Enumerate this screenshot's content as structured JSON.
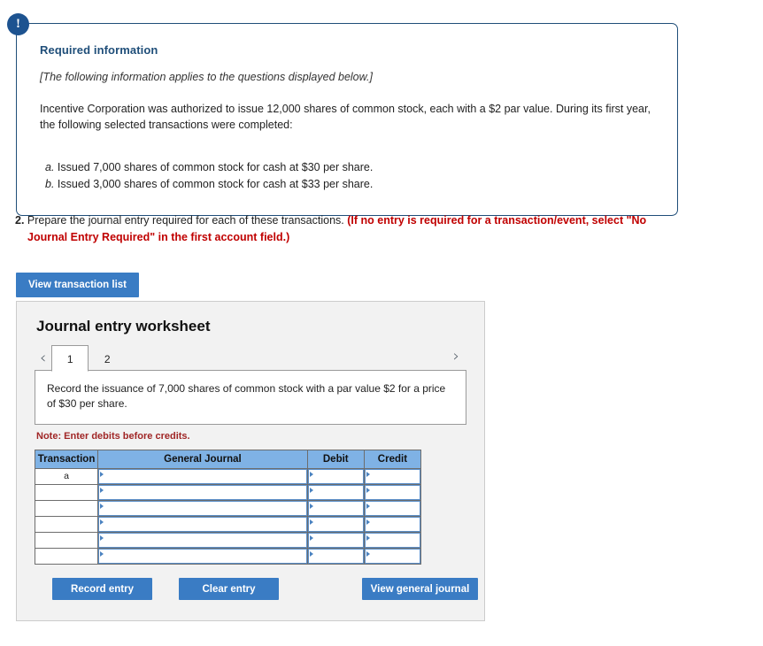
{
  "info_box": {
    "badge_icon": "exclamation-icon",
    "badge_glyph": "!",
    "title": "Required information",
    "italic_note": "[The following information applies to the questions displayed below.]",
    "paragraph": "Incentive Corporation was authorized to issue 12,000 shares of common stock, each with a $2 par value. During its first year, the following selected transactions were completed:",
    "items": [
      {
        "marker": "a.",
        "text": " Issued 7,000 shares of common stock for cash at $30 per share."
      },
      {
        "marker": "b.",
        "text": " Issued 3,000 shares of common stock for cash at $33 per share."
      }
    ],
    "border_color": "#1f4e79",
    "badge_color": "#1d5390"
  },
  "question": {
    "number": "2.",
    "text": " Prepare the journal entry required for each of these transactions. ",
    "red_line1": "(If no entry is required for a transaction/event, select \"No",
    "red_line2": "Journal Entry Required\" in the first account field.)",
    "red_color": "#c00000"
  },
  "view_transaction_list_button": {
    "label": "View transaction list",
    "color": "#3a7cc4"
  },
  "worksheet": {
    "title": "Journal entry worksheet",
    "prev_icon": "chevron-left-icon",
    "next_icon": "chevron-right-icon",
    "prev_glyph": "‹",
    "next_glyph": "›",
    "tabs": [
      {
        "label": "1",
        "active": true
      },
      {
        "label": "2",
        "active": false
      }
    ],
    "prompt": "Record the issuance of 7,000 shares of common stock with a par value $2 for a price of $30 per share.",
    "note": "Note: Enter debits before credits.",
    "note_color": "#a02626",
    "table": {
      "headers": [
        "Transaction",
        "General Journal",
        "Debit",
        "Credit"
      ],
      "header_bg": "#7fb2e5",
      "rows": [
        {
          "transaction": "a",
          "general_journal": "",
          "debit": "",
          "credit": ""
        },
        {
          "transaction": "",
          "general_journal": "",
          "debit": "",
          "credit": ""
        },
        {
          "transaction": "",
          "general_journal": "",
          "debit": "",
          "credit": ""
        },
        {
          "transaction": "",
          "general_journal": "",
          "debit": "",
          "credit": ""
        },
        {
          "transaction": "",
          "general_journal": "",
          "debit": "",
          "credit": ""
        },
        {
          "transaction": "",
          "general_journal": "",
          "debit": "",
          "credit": ""
        }
      ]
    },
    "buttons": {
      "record_entry": "Record entry",
      "clear_entry": "Clear entry",
      "view_general_journal": "View general journal"
    }
  }
}
